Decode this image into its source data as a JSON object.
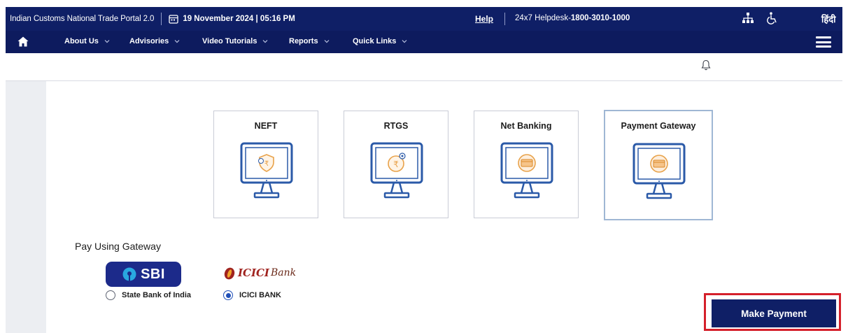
{
  "topbar": {
    "portal_title": "Indian Customs National Trade Portal 2.0",
    "datetime": "19 November 2024 | 05:16 PM",
    "help": "Help",
    "helpdesk_label": "24x7 Helpdesk-",
    "helpdesk_number": "1800-3010-1000",
    "hindi": "हिंदी"
  },
  "nav": {
    "items": [
      {
        "label": "About Us"
      },
      {
        "label": "Advisories"
      },
      {
        "label": "Video Tutorials"
      },
      {
        "label": "Reports"
      },
      {
        "label": "Quick Links"
      }
    ]
  },
  "payment_methods": [
    {
      "label": "NEFT",
      "icon": "shield-rupee-monitor-icon",
      "selected": false
    },
    {
      "label": "RTGS",
      "icon": "rupee-coin-monitor-icon",
      "selected": false
    },
    {
      "label": "Net Banking",
      "icon": "card-monitor-icon",
      "selected": false
    },
    {
      "label": "Payment Gateway",
      "icon": "card-monitor-icon",
      "selected": true
    }
  ],
  "gateway": {
    "heading": "Pay Using Gateway",
    "options": [
      {
        "logo_text": "SBI",
        "label": "State Bank of India",
        "checked": false
      },
      {
        "logo_text": "ICICI",
        "logo_suffix": "Bank",
        "label": "ICICI BANK",
        "checked": true
      }
    ]
  },
  "actions": {
    "make_payment": "Make Payment"
  },
  "colors": {
    "primary_navy": "#0f1f66",
    "highlight_red": "#d4202b",
    "icon_blue": "#2b5aa8",
    "icon_orange": "#e8a24a"
  }
}
